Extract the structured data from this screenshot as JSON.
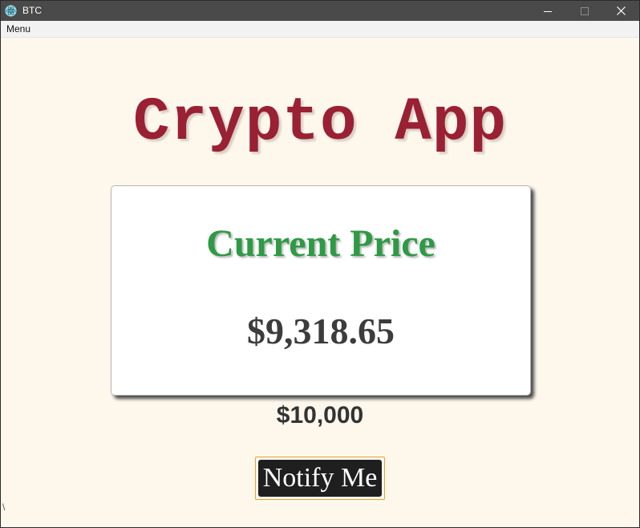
{
  "window": {
    "title": "BTC",
    "icon": "electron-atom-icon",
    "controls": [
      "minimize-icon",
      "maximize-icon",
      "close-icon"
    ]
  },
  "menubar": {
    "menu_label": "Menu"
  },
  "main": {
    "title": "Crypto App",
    "card": {
      "heading": "Current Price",
      "price": "$9,318.65"
    },
    "target_price": "$10,000",
    "notify_button": "Notify Me",
    "corner_text": "\\"
  },
  "colors": {
    "title": "#9a2034",
    "heading": "#2e9a44",
    "price": "#3c3c3c",
    "button_bg": "#1f1f1f",
    "button_outline": "#e0a33a",
    "page_bg": "#fdf7ec",
    "titlebar_bg": "#4a4a4a"
  }
}
